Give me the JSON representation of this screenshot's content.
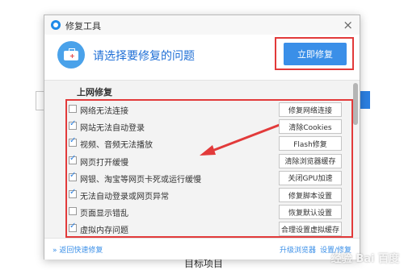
{
  "background": {
    "bottom_text": "目标项目",
    "watermark": "经验 Bai 百度"
  },
  "dialog": {
    "title": "修复工具",
    "prompt": "请选择要修复的问题",
    "primary_button": "立即修复",
    "section_title": "上网修复",
    "items": [
      {
        "label": "网络无法连接",
        "checked": false,
        "button": "修复网络连接"
      },
      {
        "label": "网站无法自动登录",
        "checked": true,
        "button": "清除Cookies"
      },
      {
        "label": "视频、音频无法播放",
        "checked": true,
        "button": "Flash修复"
      },
      {
        "label": "网页打开缓慢",
        "checked": true,
        "button": "清除浏览器缓存"
      },
      {
        "label": "网银、淘宝等网页卡死或运行缓慢",
        "checked": true,
        "button": "关闭GPU加速"
      },
      {
        "label": "无法自动登录或网页异常",
        "checked": true,
        "button": "修复脚本设置"
      },
      {
        "label": "页面显示错乱",
        "checked": false,
        "button": "恢复默认设置"
      },
      {
        "label": "虚拟内存问题",
        "checked": true,
        "button": "合理设置虚拟缓存"
      }
    ],
    "footer": {
      "back_link": "» 返回快速修复",
      "upgrade_link": "升级浏览器",
      "settings_link": "设置/修复"
    }
  },
  "colors": {
    "accent": "#3a8fe8",
    "highlight": "#e23a3a"
  }
}
